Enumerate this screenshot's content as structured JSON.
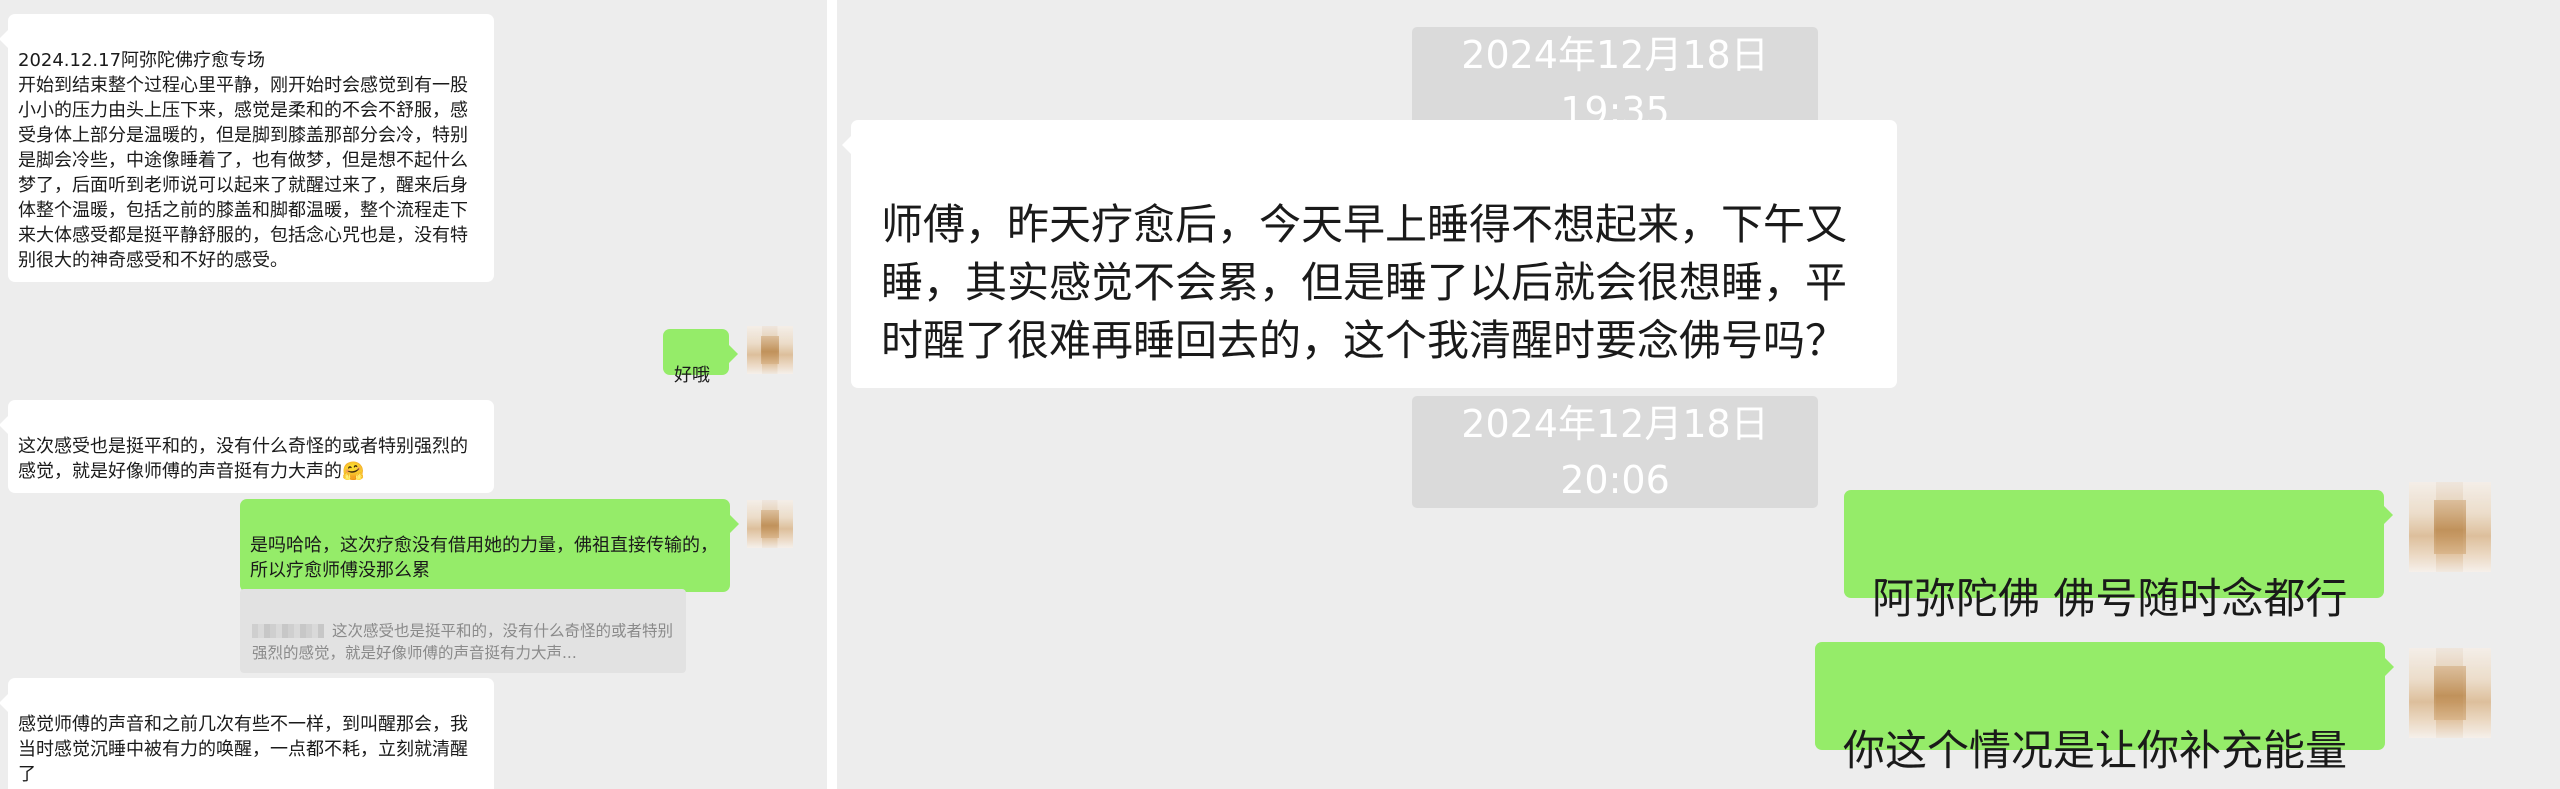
{
  "left_chat": {
    "messages": [
      {
        "text": "2024.12.17阿弥陀佛疗愈专场\n开始到结束整个过程心里平静，刚开始时会感觉到有一股小小的压力由头上压下来，感觉是柔和的不会不舒服，感受身体上部分是温暖的，但是脚到膝盖那部分会冷，特别是脚会冷些，中途像睡着了，也有做梦，但是想不起什么梦了，后面听到老师说可以起来了就醒过来了，醒来后身体整个温暖，包括之前的膝盖和脚都温暖，整个流程走下来大体感受都是挺平静舒服的，包括念心咒也是，没有特别很大的神奇感受和不好的感受。"
      },
      {
        "text": "好哦"
      },
      {
        "text": "这次感受也是挺平和的，没有什么奇怪的或者特别强烈的感觉，就是好像师傅的声音挺有力大声的",
        "emoji": "🤗"
      },
      {
        "text": "是吗哈哈，这次疗愈没有借用她的力量，佛祖直接传输的，所以疗愈师傅没那么累"
      },
      {
        "quote": "这次感受也是挺平和的，没有什么奇怪的或者特别强烈的感觉，就是好像师傅的声音挺有力大声..."
      },
      {
        "text": "感觉师傅的声音和之前几次有些不一样，到叫醒那会，我当时感觉沉睡中被有力的唤醒，一点都不耗，立刻就清醒了"
      }
    ]
  },
  "right_chat": {
    "timestamp_1": "2024年12月18日 19:35",
    "message_1": "师傅，昨天疗愈后，今天早上睡得不想起来，下午又睡，其实感觉不会累，但是睡了以后就会很想睡，平时醒了很难再睡回去的，这个我清醒时要念佛号吗？",
    "timestamp_2": "2024年12月18日 20:06",
    "reply_1": "阿弥陀佛 佛号随时念都行",
    "reply_2": "你这个情况是让你补充能量"
  },
  "colors": {
    "chat_background": "#ededed",
    "incoming_bubble": "#ffffff",
    "outgoing_bubble": "#95ec69",
    "timestamp_background": "#dadada",
    "quote_background": "#e2e2e2"
  },
  "icons": {
    "avatar": "pixelated-avatar-icon",
    "emoji": "grinning-hand-over-mouth-emoji"
  }
}
